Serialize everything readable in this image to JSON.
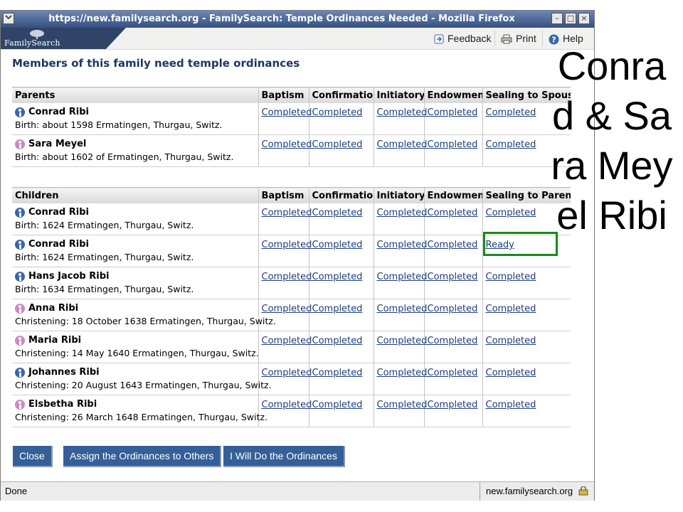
{
  "window": {
    "title": "https://new.familysearch.org - FamilySearch: Temple Ordinances Needed - Mozilla Firefox",
    "controls": {
      "minimize": "–",
      "maximize": "□",
      "close": "×"
    }
  },
  "header": {
    "logo_text": "FamilySearch",
    "links": [
      {
        "label": "Feedback",
        "icon": "feedback-icon"
      },
      {
        "label": "Print",
        "icon": "printer-icon"
      },
      {
        "label": "Help",
        "icon": "help-icon"
      }
    ]
  },
  "heading": "Members of this family need temple ordinances",
  "parents_table": {
    "columns": [
      "Parents",
      "Baptism",
      "Confirmation",
      "Initiatory",
      "Endowment",
      "Sealing to Spouse"
    ],
    "rows": [
      {
        "name": "Conrad Ribi",
        "gender": "male",
        "detail": "Birth: about 1598 Ermatingen, Thurgau, Switz.",
        "ordinances": [
          "Completed",
          "Completed",
          "Completed",
          "Completed",
          "Completed"
        ]
      },
      {
        "name": "Sara Meyel",
        "gender": "female",
        "detail": "Birth: about 1602 of Ermatingen, Thurgau, Switz.",
        "ordinances": [
          "Completed",
          "Completed",
          "Completed",
          "Completed",
          "Completed"
        ]
      }
    ]
  },
  "children_table": {
    "columns": [
      "Children",
      "Baptism",
      "Confirmation",
      "Initiatory",
      "Endowment",
      "Sealing to Parents"
    ],
    "rows": [
      {
        "name": "Conrad Ribi",
        "gender": "male",
        "detail": "Birth: 1624 Ermatingen, Thurgau, Switz.",
        "ordinances": [
          "Completed",
          "Completed",
          "Completed",
          "Completed",
          "Completed"
        ]
      },
      {
        "name": "Conrad Ribi",
        "gender": "male",
        "detail": "Birth: 1624 Ermatingen, Thurgau, Switz.",
        "ordinances": [
          "Completed",
          "Completed",
          "Completed",
          "Completed",
          "Ready"
        ]
      },
      {
        "name": "Hans Jacob Ribi",
        "gender": "male",
        "detail": "Birth: 1634 Ermatingen, Thurgau, Switz.",
        "ordinances": [
          "Completed",
          "Completed",
          "Completed",
          "Completed",
          "Completed"
        ]
      },
      {
        "name": "Anna Ribi",
        "gender": "female",
        "detail": "Christening: 18 October 1638 Ermatingen, Thurgau, Switz.",
        "ordinances": [
          "Completed",
          "Completed",
          "Completed",
          "Completed",
          "Completed"
        ]
      },
      {
        "name": "Maria Ribi",
        "gender": "female",
        "detail": "Christening: 14 May 1640 Ermatingen, Thurgau, Switz.",
        "ordinances": [
          "Completed",
          "Completed",
          "Completed",
          "Completed",
          "Completed"
        ]
      },
      {
        "name": "Johannes Ribi",
        "gender": "male",
        "detail": "Christening: 20 August 1643 Ermatingen, Thurgau, Switz.",
        "ordinances": [
          "Completed",
          "Completed",
          "Completed",
          "Completed",
          "Completed"
        ]
      },
      {
        "name": "Elsbetha Ribi",
        "gender": "female",
        "detail": "Christening: 26 March 1648 Ermatingen, Thurgau, Switz.",
        "ordinances": [
          "Completed",
          "Completed",
          "Completed",
          "Completed",
          "Completed"
        ]
      }
    ]
  },
  "buttons": {
    "close": "Close",
    "assign": "Assign the Ordinances to Others",
    "do_ordinances": "I Will Do the Ordinances"
  },
  "status_bar": {
    "text": "Done",
    "host": "new.familysearch.org"
  },
  "caption": "Conrad & Sara Meyel Ribi",
  "colors": {
    "title_bar": "#35507f",
    "link": "#1a3f7a",
    "button": "#345f97",
    "highlight": "#1a8a1a"
  }
}
